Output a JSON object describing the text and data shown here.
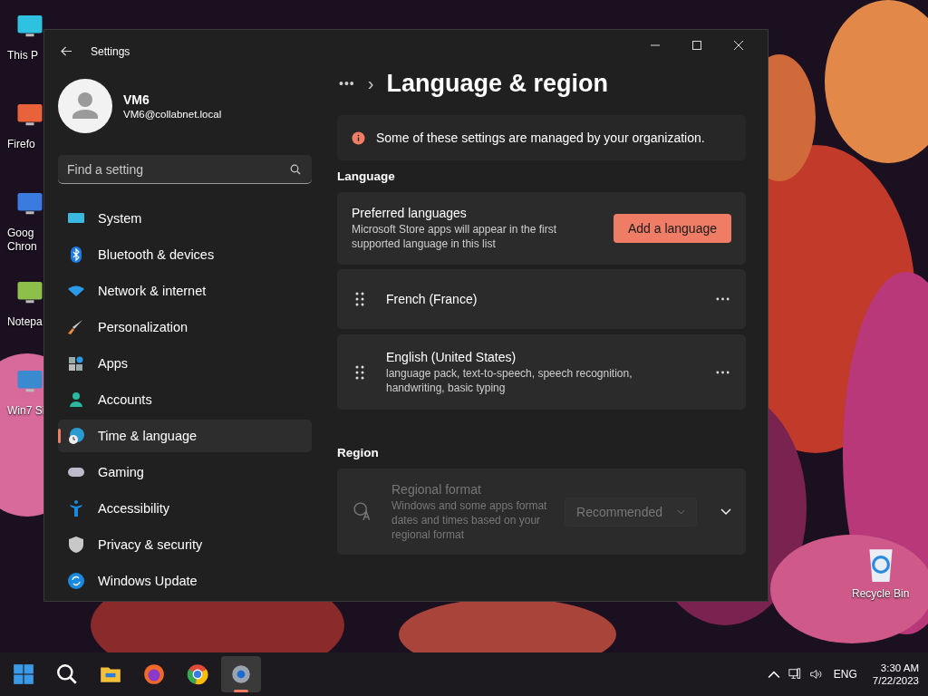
{
  "desktop_icons": [
    {
      "lines": [
        "This P"
      ]
    },
    {
      "lines": [
        "Firefo"
      ]
    },
    {
      "lines": [
        "Goog",
        "Chron"
      ]
    },
    {
      "lines": [
        "Notepa"
      ]
    },
    {
      "lines": [
        "Win7 Si"
      ]
    }
  ],
  "recycle_bin": {
    "label": "Recycle Bin"
  },
  "window": {
    "title": "Settings"
  },
  "user": {
    "name": "VM6",
    "email": "VM6@collabnet.local"
  },
  "search": {
    "placeholder": "Find a setting"
  },
  "nav_items": [
    {
      "label": "System",
      "selected": false
    },
    {
      "label": "Bluetooth & devices",
      "selected": false
    },
    {
      "label": "Network & internet",
      "selected": false
    },
    {
      "label": "Personalization",
      "selected": false
    },
    {
      "label": "Apps",
      "selected": false
    },
    {
      "label": "Accounts",
      "selected": false
    },
    {
      "label": "Time & language",
      "selected": true
    },
    {
      "label": "Gaming",
      "selected": false
    },
    {
      "label": "Accessibility",
      "selected": false
    },
    {
      "label": "Privacy & security",
      "selected": false
    },
    {
      "label": "Windows Update",
      "selected": false
    }
  ],
  "breadcrumb": {
    "overflow": "•••",
    "separator": "›",
    "title": "Language & region"
  },
  "notice": {
    "text": "Some of these settings are managed by your organization."
  },
  "language": {
    "heading": "Language",
    "preferred": {
      "title": "Preferred languages",
      "description": "Microsoft Store apps will appear in the first supported language in this list",
      "button": "Add a language"
    },
    "languages": [
      {
        "name": "French (France)"
      },
      {
        "name": "English (United States)",
        "details": "language pack, text-to-speech, speech recognition, handwriting, basic typing"
      }
    ]
  },
  "region": {
    "heading": "Region",
    "regional_format": {
      "title": "Regional format",
      "description": "Windows and some apps format dates and times based on your regional format",
      "value": "Recommended",
      "disabled": true
    }
  },
  "taskbar": {
    "apps": [
      {
        "selected": false
      },
      {
        "selected": false
      },
      {
        "selected": false
      },
      {
        "selected": false
      },
      {
        "selected": false
      },
      {
        "selected": true
      }
    ],
    "input_language": "ENG",
    "time": "3:30 AM",
    "date": "7/22/2023"
  }
}
